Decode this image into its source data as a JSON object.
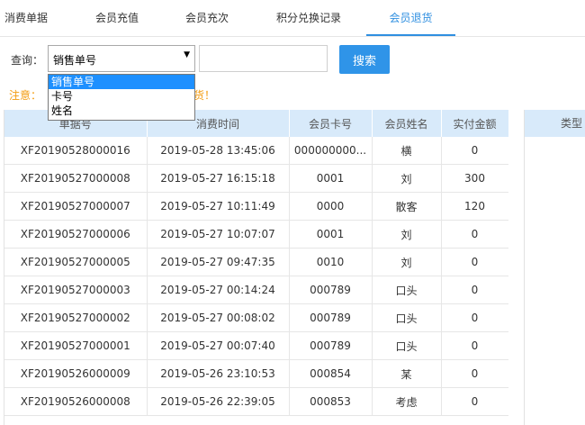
{
  "tabs": [
    {
      "label": "消费单据",
      "active": false
    },
    {
      "label": "会员充值",
      "active": false
    },
    {
      "label": "会员充次",
      "active": false
    },
    {
      "label": "积分兑换记录",
      "active": false
    },
    {
      "label": "会员退货",
      "active": true
    }
  ],
  "query": {
    "label": "查询：",
    "select_value": "销售单号",
    "search_value": "",
    "search_button": "搜索"
  },
  "dropdown": {
    "options": [
      "销售单号",
      "卡号",
      "姓名"
    ],
    "selected_index": 0
  },
  "note": {
    "prefix": "注意：",
    "suffix": "货！"
  },
  "table": {
    "columns": [
      "单据号",
      "消费时间",
      "会员卡号",
      "会员姓名",
      "实付金额"
    ],
    "rows": [
      [
        "XF20190528000016",
        "2019-05-28 13:45:06",
        "000000000...",
        "横",
        "0"
      ],
      [
        "XF20190527000008",
        "2019-05-27 16:15:18",
        "0001",
        "刘",
        "300"
      ],
      [
        "XF20190527000007",
        "2019-05-27 10:11:49",
        "0000",
        "散客",
        "120"
      ],
      [
        "XF20190527000006",
        "2019-05-27 10:07:07",
        "0001",
        "刘",
        "0"
      ],
      [
        "XF20190527000005",
        "2019-05-27 09:47:35",
        "0010",
        "刘",
        "0"
      ],
      [
        "XF20190527000003",
        "2019-05-27 00:14:24",
        "000789",
        "口头",
        "0"
      ],
      [
        "XF20190527000002",
        "2019-05-27 00:08:02",
        "000789",
        "口头",
        "0"
      ],
      [
        "XF20190527000001",
        "2019-05-27 00:07:40",
        "000789",
        "口头",
        "0"
      ],
      [
        "XF20190526000009",
        "2019-05-26 23:10:53",
        "000854",
        "某",
        "0"
      ],
      [
        "XF20190526000008",
        "2019-05-26 22:39:05",
        "000853",
        "考虑",
        "0"
      ]
    ]
  },
  "right_panel": {
    "header": "类型"
  },
  "colors": {
    "accent": "#2f8fe0",
    "header_bg": "#d8eafa",
    "note": "#f39c12",
    "dropdown_selected": "#1e90ff"
  }
}
